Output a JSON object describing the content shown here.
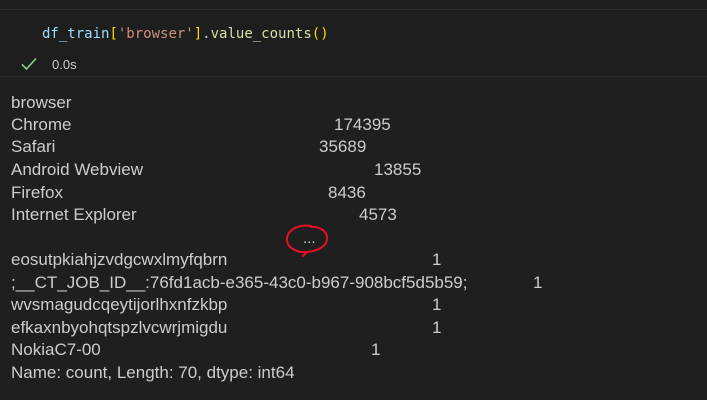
{
  "cell": {
    "code": {
      "var": "df_train",
      "open_bracket": "[",
      "key": "'browser'",
      "close_bracket": "]",
      "dot": ".",
      "method": "value_counts",
      "parens": "()"
    },
    "exec_time": "0.0s"
  },
  "output": {
    "index_name": "browser",
    "rows_top": [
      {
        "label": "Chrome",
        "value": "174395"
      },
      {
        "label": "Safari",
        "value": "35689"
      },
      {
        "label": "Android Webview",
        "value": "13855"
      },
      {
        "label": "Firefox",
        "value": "8436"
      },
      {
        "label": "Internet Explorer",
        "value": "4573"
      }
    ],
    "ellipsis": "...",
    "rows_bottom": [
      {
        "label": "eosutpkiahjzvdgcwxlmyfqbrn",
        "value": "1"
      },
      {
        "label": ";__CT_JOB_ID__:76fd1acb-e365-43c0-b967-908bcf5d5b59;",
        "value": "1"
      },
      {
        "label": "wvsmagudcqeytijorlhxnfzkbp",
        "value": "1"
      },
      {
        "label": "efkaxnbyohqtspzlvcwrjmigdu",
        "value": "1"
      },
      {
        "label": "NokiaC7-00",
        "value": "1"
      }
    ],
    "footer": "Name: count, Length: 70, dtype: int64"
  },
  "icons": {
    "check": "check-icon"
  },
  "colors": {
    "background": "#1f1f1f",
    "check": "#89d185",
    "annotation": "#e81123",
    "text": "#cccccc"
  }
}
